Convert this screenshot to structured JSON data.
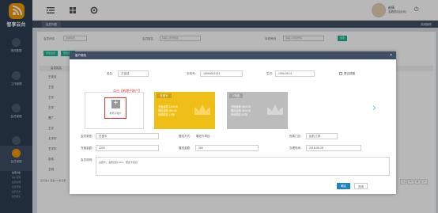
{
  "app": {
    "logo_text": "智享云台"
  },
  "topbar": {
    "user_name": "赵倩",
    "user_role": "会籍顾问(店长)",
    "menu_icon": "collapse-icon",
    "grid_icon": "grid-icon",
    "settings_icon": "gear-icon"
  },
  "sidebar": {
    "items": [
      {
        "label": "首页数据"
      },
      {
        "label": "工作管理"
      },
      {
        "label": "会员管理"
      },
      {
        "label": "商品管理"
      },
      {
        "label": "会员管理"
      }
    ],
    "sub_items": [
      {
        "label": "会员列表"
      },
      {
        "label": "客户管理"
      },
      {
        "label": "会员管理"
      },
      {
        "label": "会员管理"
      },
      {
        "label": "会员日志"
      },
      {
        "label": "会员报表"
      }
    ]
  },
  "breadcrumb": {
    "tab": "会员列表",
    "right_menu": "关闭操作"
  },
  "filters": {
    "label1": "会员状态",
    "value1": "选择会员",
    "label2": "会员姓名",
    "placeholder2": "请输入会员姓名",
    "label3": "手机号码",
    "placeholder3": "请输入手机号码",
    "search_label": "搜索"
  },
  "toolbar": {
    "btn1": "添加会员",
    "btn2": "导出会员"
  },
  "list": {
    "header": "会员姓名",
    "rows": [
      "王佳佳",
      "王佳",
      "王宇",
      "王宇",
      "曹广",
      "王宇",
      "王宇宇",
      "王宇宇",
      "张伟",
      "王明"
    ],
    "total": "显示第 1 至第 10 条记录",
    "pages": [
      "<",
      "1",
      "2",
      ">"
    ]
  },
  "modal": {
    "title": "客户修改",
    "close": "×",
    "name_label": "姓名：",
    "name_value": "王佳佳",
    "phone_label": "手机号：",
    "phone_value": "15994021021",
    "birthday_label": "生日：",
    "birthday_value": "1996-05-11",
    "remind_label": "是否提醒",
    "add_card_label": "新增子账户",
    "annotation": "点击【新增子账户】",
    "cards": [
      {
        "badge": "白银卡",
        "line1": "充值金额 2200.00",
        "line2": "赠送金额 260.00",
        "line3": "有效期至 1.0折"
      },
      {
        "badge": "V铂金",
        "line1": "充值金额 3600.00",
        "line2": "赠送金额 3600.00",
        "line3": "有效期至 6.0折"
      }
    ],
    "card_type_label": "会员类型：",
    "card_type_value": "白银卡",
    "pay_label": "赠送方式：",
    "pay_value": "赠送卡项目",
    "store_label": "所属门店：",
    "store_value": "民航江滨",
    "recharge_label": "充值金额：",
    "recharge_value": "2200",
    "gift_label": "赠送金额：",
    "gift_value": "260",
    "date_label": "办理时间：",
    "date_value": "2018-05-28",
    "remark_label": "会员说明：",
    "remark_value": "白银卡，消费折扣 10%，赠送卡项目",
    "confirm_label": "确定",
    "cancel_label": "关闭"
  },
  "colors": {
    "sidebar": "#2f3d52",
    "accent": "#f39800",
    "gold": "#f0bf17",
    "primary": "#1c84c6",
    "green": "#1ab394"
  }
}
